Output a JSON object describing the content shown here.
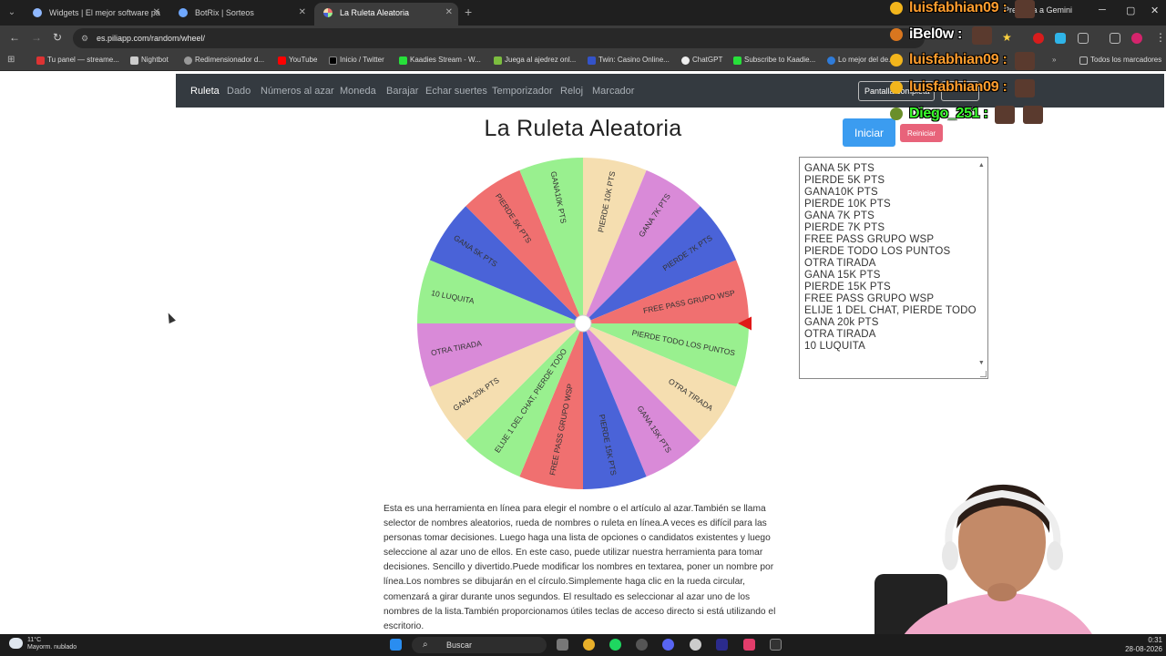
{
  "browser": {
    "tabs": [
      {
        "label": "Widgets | El mejor software pa",
        "active": false
      },
      {
        "label": "BotRix | Sorteos",
        "active": false
      },
      {
        "label": "La Ruleta Aleatoria",
        "active": true
      }
    ],
    "url": "es.piliapp.com/random/wheel/",
    "gemini_label": "Pregunta a Gemini",
    "bookmarks": [
      "Tu panel — streame...",
      "Nightbot",
      "Redimensionador d...",
      "YouTube",
      "Inicio / Twitter",
      "Kaadies Stream - W...",
      "Juega al ajedrez onl...",
      "Twin: Casino Online...",
      "ChatGPT",
      "Subscribe to Kaadie...",
      "Lo mejor del de..."
    ],
    "all_bookmarks": "Todos los marcadores"
  },
  "site": {
    "nav": [
      "Ruleta",
      "Dado",
      "Números al azar",
      "Moneda",
      "Barajar",
      "Echar suertes",
      "Temporizador",
      "Reloj",
      "Marcador"
    ],
    "fullscreen_label": "Pantalla completa",
    "title": "La Ruleta Aleatoria",
    "start_button": "Iniciar",
    "reset_button": "Reiniciar",
    "options": [
      "GANA 5K PTS",
      "PIERDE 5K PTS",
      "GANA10K PTS",
      "PIERDE 10K PTS",
      "GANA 7K PTS",
      "PIERDE 7K PTS",
      "FREE PASS GRUPO WSP",
      "PIERDE TODO LOS PUNTOS",
      "OTRA TIRADA",
      "GANA 15K PTS",
      "PIERDE 15K PTS",
      "FREE PASS GRUPO WSP",
      "ELIJE 1 DEL CHAT, PIERDE TODO",
      "GANA 20k PTS",
      "OTRA TIRADA",
      "10 LUQUITA"
    ],
    "wheel_labels": [
      "PIERDE 10K PTS",
      "GANA 7K PTS",
      "PIERDE 7K PTS",
      "FREE PASS GRUPO WSP",
      "PIERDE TODO LOS PUNTOS",
      "OTRA TIRADA",
      "GANA 15K PTS",
      "PIERDE 15K PTS",
      "FREE PASS GRUPO WSP",
      "ELIJE 1 DEL CHAT, PIERDE TODO",
      "GANA 20k PTS",
      "OTRA TIRADA",
      "10 LUQUITA",
      "GANA 5K PTS",
      "PIERDE 5K PTS",
      "GANA10K PTS"
    ],
    "wheel_colors": [
      "#f5deb0",
      "#d98ad8",
      "#4a63d8",
      "#f07070",
      "#99f08f",
      "#f5deb0",
      "#d98ad8",
      "#4a63d8",
      "#f07070",
      "#99f08f",
      "#f5deb0",
      "#d98ad8",
      "#99f08f",
      "#4a63d8",
      "#f07070",
      "#99f08f"
    ],
    "pointer_color": "#e01818",
    "description": "Esta es una herramienta en línea para elegir el nombre o el artículo al azar.También se llama selector de nombres aleatorios, rueda de nombres o ruleta en línea.A veces es difícil para las personas tomar decisiones. Luego haga una lista de opciones o candidatos existentes y luego seleccione al azar uno de ellos. En este caso, puede utilizar nuestra herramienta para tomar decisiones. Sencillo y divertido.Puede modificar los nombres en textarea, poner un nombre por línea.Los nombres se dibujarán en el círculo.Simplemente haga clic en la rueda circular, comenzará a girar durante unos segundos. El resultado es seleccionar al azar uno de los nombres de la lista.También proporcionamos útiles teclas de acceso directo si está utilizando el escritorio."
  },
  "chat": [
    {
      "name": "luisfabhian09 :",
      "color": "#ff9d2e"
    },
    {
      "name": "iBel0w :",
      "color": "#ffffff"
    },
    {
      "name": "luisfabhian09 :",
      "color": "#ff9d2e"
    },
    {
      "name": "luisfabhian09 :",
      "color": "#ff9d2e"
    },
    {
      "name": "Diego_251 :",
      "color": "#3cff2e"
    }
  ],
  "taskbar": {
    "temperature": "11°C",
    "weather": "Mayorm. nublado",
    "search": "Buscar",
    "time": "0:31",
    "date": "28-08-2026"
  }
}
